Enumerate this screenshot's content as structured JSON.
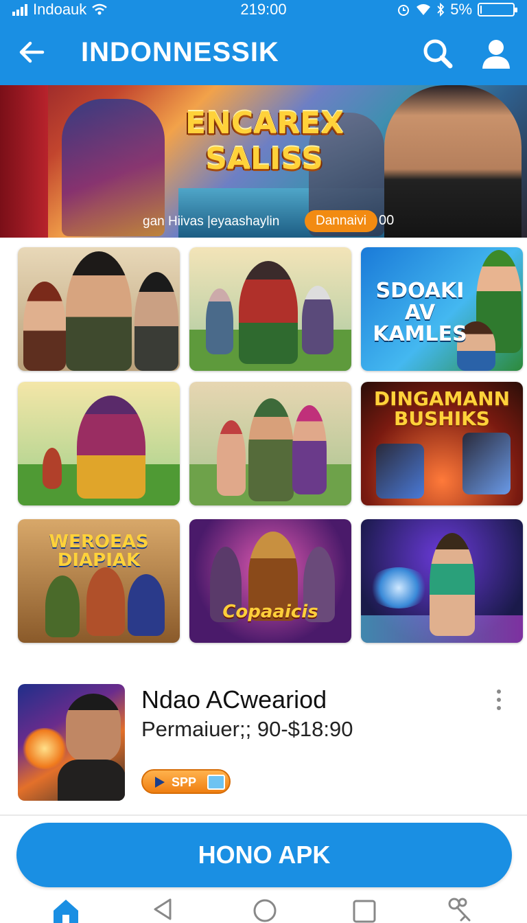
{
  "status_bar": {
    "carrier": "Indoauk",
    "time": "219:00",
    "battery": "5%",
    "battery_level": 0.05,
    "icons": [
      "signal-icon",
      "wifi-icon",
      "alarm-icon",
      "bluetooth-icon",
      "battery-icon"
    ]
  },
  "app_bar": {
    "title": "INDONNESSIK",
    "icons": [
      "back-arrow-icon",
      "search-icon",
      "profile-icon"
    ]
  },
  "banner": {
    "headline_line1": "ENCAREX",
    "headline_line2": "SALISS",
    "caption": "gan Hiivas |eyaashaylin",
    "pill": "Dannaivi",
    "number": "00"
  },
  "grid": {
    "tiles": [
      {
        "title": ""
      },
      {
        "title": ""
      },
      {
        "title": "SDOAKI AV KAMLES"
      },
      {
        "title": ""
      },
      {
        "title": ""
      },
      {
        "title": "DINGAMANN BUSHIKS"
      },
      {
        "title": "WEROEAS DIAPIAK"
      },
      {
        "title": "Copaaicis"
      },
      {
        "title": ""
      }
    ]
  },
  "list_item": {
    "name": "Ndao ACweariod",
    "price": "Permaiuer;; 90-$18:90",
    "badge": "SPP"
  },
  "cta": {
    "label": "HONO APK"
  },
  "bottom_nav": {
    "icons": [
      "home-icon",
      "back-triangle-icon",
      "home-circle-icon",
      "recents-square-icon",
      "tools-icon"
    ]
  },
  "colors": {
    "primary": "#1a8fe3",
    "accent_orange": "#f28b12",
    "text_dark": "#111111"
  }
}
